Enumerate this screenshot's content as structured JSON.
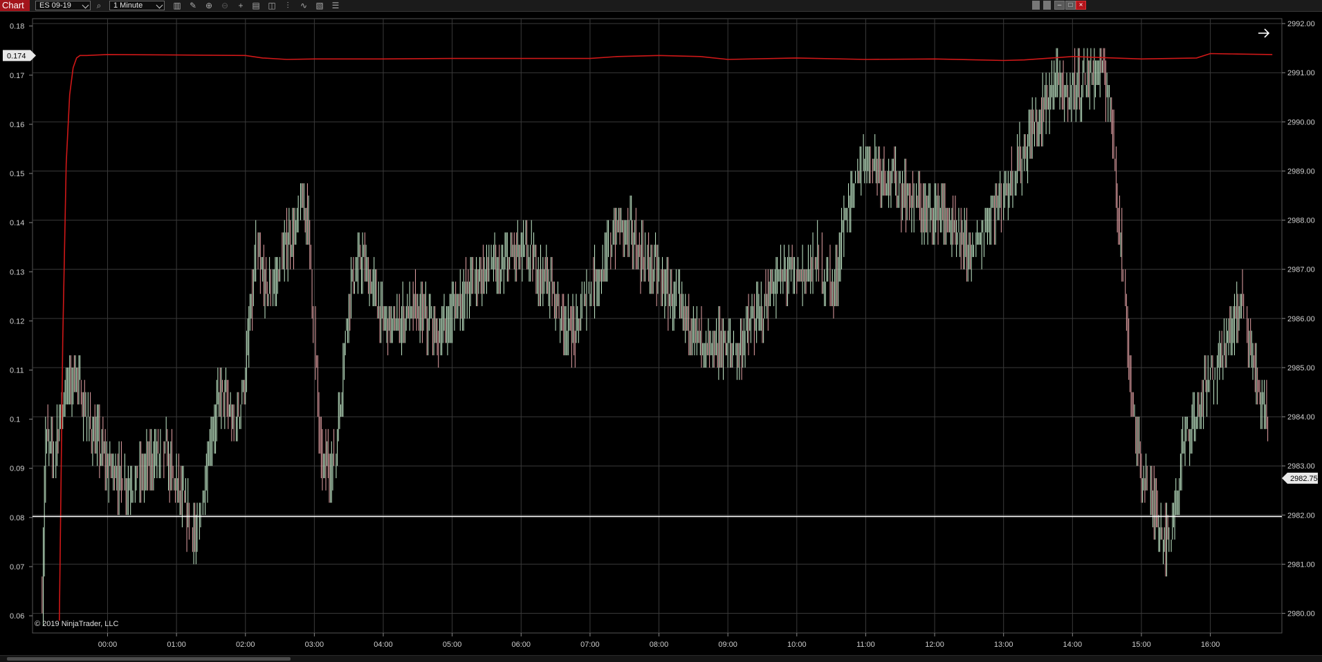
{
  "app": {
    "title": "Chart"
  },
  "toolbar": {
    "instrument": "ES 09-19",
    "interval": "1 Minute",
    "icons": [
      "search-icon",
      "bar-type-icon",
      "pencil-icon",
      "zoom-in-icon",
      "zoom-out-icon",
      "crosshair-icon",
      "properties-icon",
      "templates-icon",
      "indicators-icon",
      "strategies-icon",
      "data-box-icon",
      "chart-trader-icon"
    ]
  },
  "window_controls": {
    "minimize": "–",
    "maximize": "□",
    "close": "×"
  },
  "colors": {
    "background": "#000000",
    "grid": "#3a3a3a",
    "up_bar": "#c8f0cf",
    "down_bar": "#e8a4a8",
    "indicator": "#d01818",
    "hline": "#ffffff",
    "title_bar": "#a3141b"
  },
  "chart_data": {
    "type": "line",
    "xlabel": "",
    "ylabel": "",
    "x_ticks": [
      "00:00",
      "01:00",
      "02:00",
      "03:00",
      "04:00",
      "05:00",
      "06:00",
      "07:00",
      "08:00",
      "09:00",
      "10:00",
      "11:00",
      "12:00",
      "13:00",
      "14:00",
      "15:00",
      "16:00"
    ],
    "right_axis": {
      "ylim": [
        2979.6,
        2992.1
      ],
      "ticks": [
        "2980.00",
        "2981.00",
        "2982.00",
        "2983.00",
        "2984.00",
        "2985.00",
        "2986.00",
        "2987.00",
        "2988.00",
        "2989.00",
        "2990.00",
        "2991.00",
        "2992.00"
      ]
    },
    "left_axis": {
      "ylim": [
        0.0565,
        0.1815
      ],
      "ticks": [
        "0.06",
        "0.07",
        "0.08",
        "0.09",
        "0.1",
        "0.11",
        "0.12",
        "0.13",
        "0.14",
        "0.15",
        "0.16",
        "0.17",
        "0.18"
      ]
    },
    "series": [
      {
        "axis": "right",
        "style": "ohlc-bars",
        "x_hours": [
          -0.95,
          -0.9,
          -0.8,
          -0.6,
          -0.45,
          -0.3,
          0,
          0.3,
          0.6,
          0.8,
          1.0,
          1.15,
          1.3,
          1.5,
          1.65,
          1.85,
          2.0,
          2.15,
          2.3,
          2.45,
          2.6,
          2.75,
          2.8,
          2.9,
          3.1,
          3.3,
          3.5,
          3.7,
          4.0,
          4.2,
          4.45,
          4.6,
          4.8,
          5.0,
          5.2,
          5.5,
          5.7,
          5.9,
          6.1,
          6.4,
          6.6,
          6.8,
          7.0,
          7.2,
          7.35,
          7.5,
          7.7,
          7.9,
          8.1,
          8.3,
          8.5,
          8.7,
          8.9,
          9.1,
          9.3,
          9.5,
          9.7,
          9.9,
          10.05,
          10.3,
          10.55,
          10.7,
          10.85,
          11.0,
          11.2,
          11.5,
          11.7,
          11.9,
          12.1,
          12.3,
          12.55,
          12.8,
          13.0,
          13.2,
          13.4,
          13.6,
          13.75,
          13.9,
          14.1,
          14.25,
          14.4,
          14.55,
          14.7,
          14.85,
          15.0,
          15.2,
          15.4,
          15.6,
          15.8,
          16.0,
          16.15,
          16.3,
          16.45,
          16.55,
          16.7,
          16.85
        ],
        "y": [
          2980.3,
          2983.6,
          2983.2,
          2984.6,
          2984.9,
          2983.9,
          2983.0,
          2982.6,
          2983.0,
          2983.4,
          2982.6,
          2982.0,
          2981.5,
          2983.6,
          2984.5,
          2983.7,
          2984.8,
          2987.3,
          2986.6,
          2986.8,
          2987.5,
          2987.8,
          2988.4,
          2988.2,
          2983.0,
          2983.1,
          2986.5,
          2987.2,
          2986.0,
          2985.9,
          2986.2,
          2986.0,
          2985.6,
          2986.1,
          2986.6,
          2987.1,
          2986.9,
          2987.4,
          2987.3,
          2986.7,
          2986.0,
          2985.7,
          2986.7,
          2987.0,
          2987.7,
          2988.0,
          2987.3,
          2987.1,
          2986.6,
          2986.2,
          2985.8,
          2985.2,
          2985.5,
          2985.3,
          2985.8,
          2986.2,
          2986.7,
          2987.0,
          2986.8,
          2987.2,
          2986.6,
          2988.1,
          2988.7,
          2989.4,
          2989.1,
          2988.6,
          2988.4,
          2988.1,
          2988.2,
          2987.6,
          2987.3,
          2988.1,
          2988.5,
          2989.1,
          2989.7,
          2990.3,
          2990.8,
          2990.6,
          2990.8,
          2990.9,
          2991.1,
          2990.4,
          2987.5,
          2984.5,
          2982.9,
          2982.1,
          2981.4,
          2983.3,
          2984.1,
          2984.8,
          2985.3,
          2985.8,
          2986.3,
          2985.5,
          2984.6,
          2983.9,
          2983.0,
          2982.6
        ]
      },
      {
        "axis": "left",
        "style": "line",
        "x_hours": [
          -0.7,
          -0.65,
          -0.6,
          -0.55,
          -0.5,
          -0.45,
          -0.4,
          -0.3,
          0,
          1,
          2,
          2.25,
          2.6,
          3,
          4,
          5,
          6,
          7,
          7.4,
          8,
          8.6,
          9,
          10,
          11,
          12,
          13,
          13.3,
          14,
          15,
          15.8,
          16,
          16.4,
          16.9
        ],
        "y": [
          0.059,
          0.116,
          0.152,
          0.166,
          0.1715,
          0.1735,
          0.174,
          0.174,
          0.1742,
          0.1741,
          0.174,
          0.1735,
          0.1732,
          0.1733,
          0.1733,
          0.1734,
          0.1734,
          0.1734,
          0.1738,
          0.174,
          0.1738,
          0.1732,
          0.1735,
          0.1732,
          0.1733,
          0.173,
          0.1731,
          0.1738,
          0.1733,
          0.1735,
          0.1744,
          0.1743,
          0.1742
        ]
      }
    ],
    "horizontal_line": {
      "axis": "left",
      "value": 0.0802
    },
    "price_marker": "2982.75",
    "indicator_marker": "0.174",
    "copyright": "© 2019 NinjaTrader, LLC",
    "grid": true
  }
}
